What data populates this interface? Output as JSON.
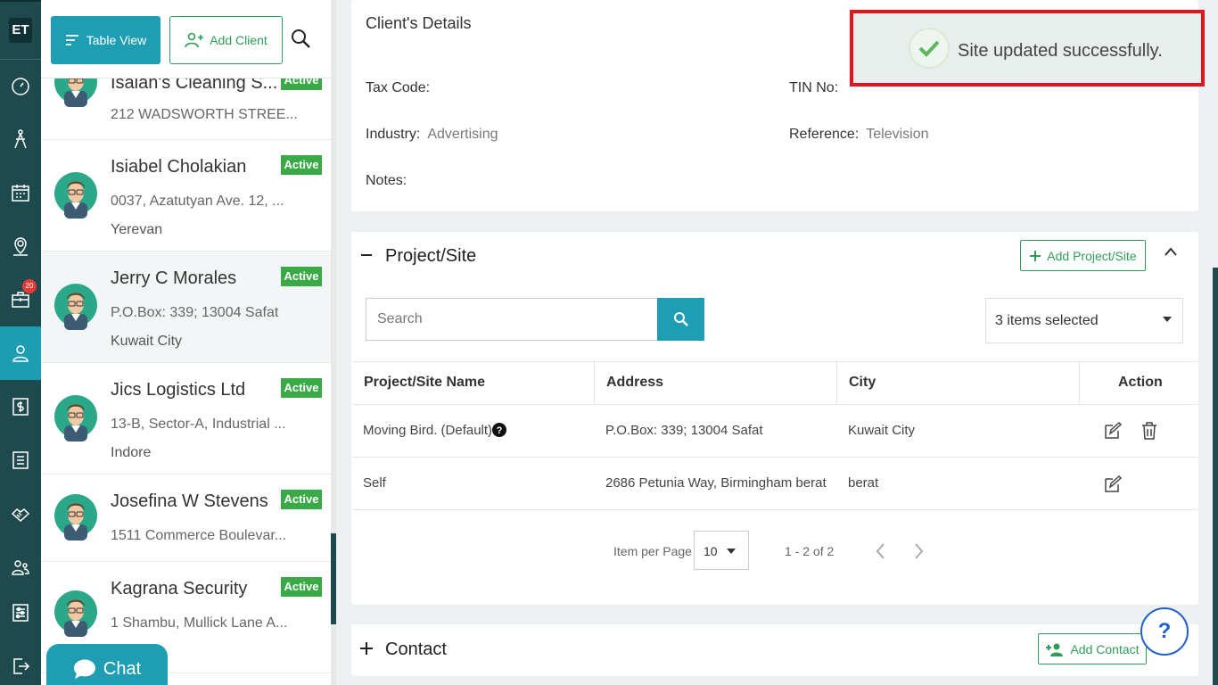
{
  "rail": {
    "logo": "ET",
    "badge": "20"
  },
  "toolbar": {
    "table_view": "Table View",
    "add_client": "Add Client"
  },
  "clients": [
    {
      "name": "Isaiah's Cleaning S...",
      "address": "212 WADSWORTH STREE...",
      "city": "",
      "status": "Active"
    },
    {
      "name": "Isiabel  Cholakian",
      "address": "0037, Azatutyan Ave. 12, ...",
      "city": "Yerevan",
      "status": "Active"
    },
    {
      "name": "Jerry C Morales",
      "address": "P.O.Box: 339; 13004 Safat",
      "city": "Kuwait City",
      "status": "Active"
    },
    {
      "name": "Jics Logistics Ltd",
      "address": "13-B, Sector-A, Industrial ...",
      "city": "Indore",
      "status": "Active"
    },
    {
      "name": "Josefina W Stevens",
      "address": "1511 Commerce Boulevar...",
      "city": "",
      "status": "Active"
    },
    {
      "name": "Kagrana Security",
      "address": "1 Shambu, Mullick Lane A...",
      "city": "",
      "status": "Active"
    }
  ],
  "chat": {
    "label": "Chat"
  },
  "details": {
    "title": "Client's Details",
    "tax_code_label": "Tax Code:",
    "tin_label": "TIN No:",
    "industry_label": "Industry:",
    "industry_value": "Advertising",
    "reference_label": "Reference:",
    "reference_value": "Television",
    "notes_label": "Notes:"
  },
  "toast": {
    "message": "Site updated successfully."
  },
  "project": {
    "title": "Project/Site",
    "add_label": "Add Project/Site",
    "search_placeholder": "Search",
    "selected": "3 items selected",
    "headers": [
      "Project/Site Name",
      "Address",
      "City",
      "Action"
    ],
    "rows": [
      {
        "name": "Moving Bird. (Default)",
        "address": "P.O.Box: 339; 13004 Safat",
        "city": "Kuwait City"
      },
      {
        "name": "Self",
        "address": "2686 Petunia Way, Birmingham berat",
        "city": "berat"
      }
    ],
    "per_page_label": "Item per Page",
    "per_page": "10",
    "range": "1 - 2 of 2"
  },
  "contact": {
    "title": "Contact",
    "add_label": "Add Contact"
  },
  "help": {
    "label": "?"
  },
  "colors": {
    "accent": "#1f9db3",
    "sidebar": "#1f4a4d",
    "active": "#3aaa47",
    "add_green": "#2e9e57"
  }
}
